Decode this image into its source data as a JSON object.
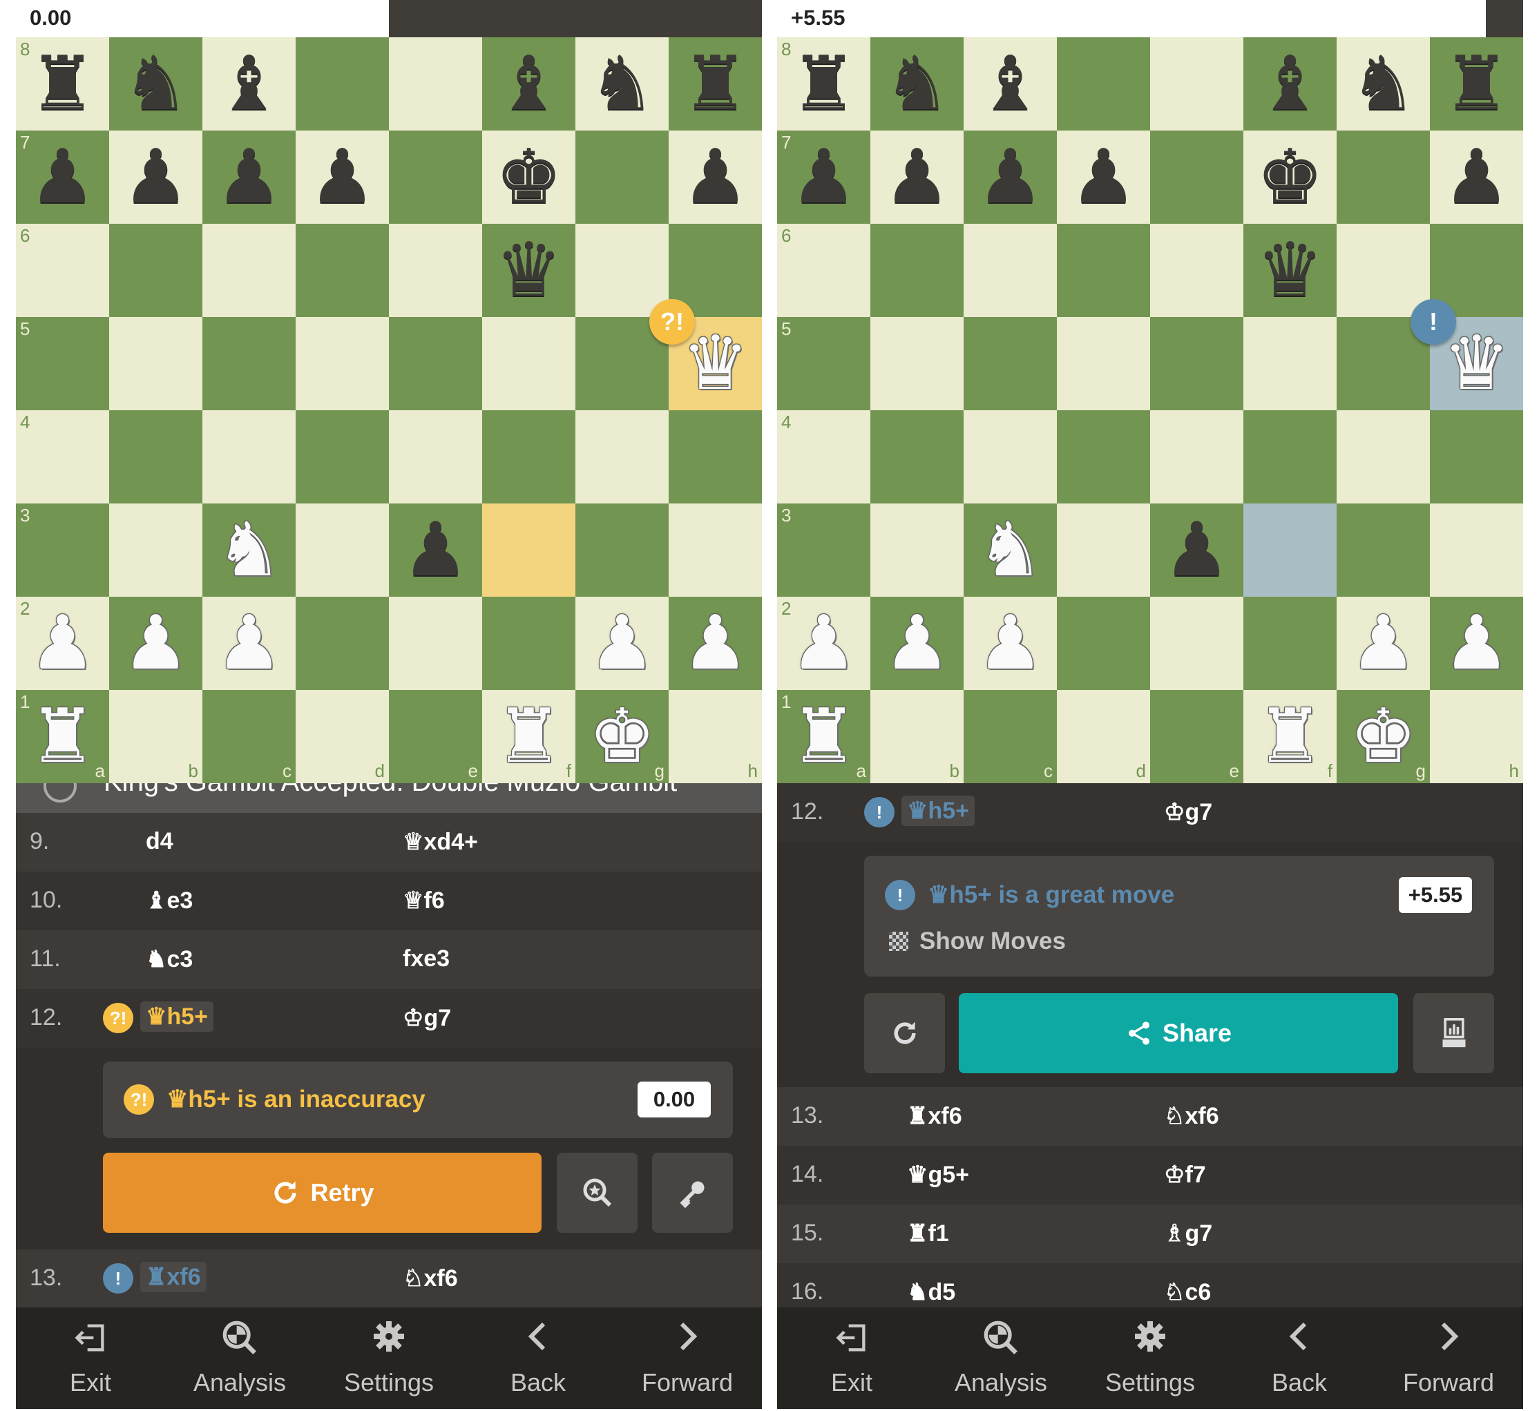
{
  "colors": {
    "light": "#ebecd0",
    "dark": "#739552",
    "inaccuracy": "#f7c045",
    "great": "#5c8bb0",
    "retry": "#e6912c",
    "share": "#0fa9a4"
  },
  "files": [
    "a",
    "b",
    "c",
    "d",
    "e",
    "f",
    "g",
    "h"
  ],
  "panels": [
    {
      "eval": {
        "text": "0.00",
        "white_fraction": 0.5
      },
      "board": {
        "rows": [
          "rnb..bnr",
          "pppp.k.p",
          ".....q..",
          ".......Q",
          "........",
          "..N.p...",
          "PPP...PP",
          "R....RK."
        ],
        "highlights": [
          "h5",
          "f3"
        ],
        "highlight_color": "#f3d580",
        "badge": {
          "square": "h5",
          "symbol": "?!",
          "color": "#f7c045",
          "icon": "inaccuracy-icon"
        }
      },
      "opening": "King's Gambit Accepted: Double Muzio Gambit",
      "moves_before": [
        {
          "num": "9.",
          "white": "d4",
          "black": "♕xd4+"
        },
        {
          "num": "10.",
          "white": "♝e3",
          "black": "♕f6"
        },
        {
          "num": "11.",
          "white": "♞c3",
          "black": "fxe3"
        },
        {
          "num": "12.",
          "white": "♛h5+",
          "black": "♔g7",
          "badge": "?!",
          "badge_color": "#f7c045",
          "white_color": "#f7c045"
        }
      ],
      "feedback": {
        "badge": "?!",
        "color": "#f7c045",
        "text": "♛h5+ is an inaccuracy",
        "eval": "0.00",
        "main_button": {
          "label": "Retry",
          "icon": "retry-icon",
          "color": "#e6912c"
        },
        "side_buttons": [
          "zoom-search-icon",
          "key-icon"
        ]
      },
      "moves_after": [
        {
          "num": "13.",
          "white": "♜xf6",
          "black": "♘xf6",
          "badge": "!",
          "badge_color": "#5c8bb0",
          "white_color": "#5c8bb0"
        }
      ]
    },
    {
      "eval": {
        "text": "+5.55",
        "white_fraction": 0.95
      },
      "board": {
        "rows": [
          "rnb..bnr",
          "pppp.k.p",
          ".....q..",
          ".......Q",
          "........",
          "..N.p...",
          "PPP...PP",
          "R....RK."
        ],
        "highlights": [
          "h5",
          "f3"
        ],
        "highlight_color": "#a9bec5",
        "badge": {
          "square": "h5",
          "symbol": "!",
          "color": "#5c8bb0",
          "icon": "great-move-icon"
        }
      },
      "moves_before": [
        {
          "num": "12.",
          "white": "♛h5+",
          "black": "♔g7",
          "badge": "!",
          "badge_color": "#5c8bb0",
          "white_color": "#5c8bb0"
        }
      ],
      "feedback": {
        "badge": "!",
        "color": "#5c8bb0",
        "text": "♛h5+ is a great move",
        "eval": "+5.55",
        "show_moves": "Show Moves",
        "main_button": {
          "label": "Share",
          "icon": "share-icon",
          "color": "#0fa9a4"
        },
        "side_buttons": [
          "retry-icon",
          "analysis-report-icon"
        ]
      },
      "moves_after": [
        {
          "num": "13.",
          "white": "♜xf6",
          "black": "♘xf6"
        },
        {
          "num": "14.",
          "white": "♛g5+",
          "black": "♔f7"
        },
        {
          "num": "15.",
          "white": "♜f1",
          "black": "♗g7"
        },
        {
          "num": "16.",
          "white": "♞d5",
          "black": "♘c6"
        }
      ]
    }
  ],
  "nav": [
    {
      "label": "Exit",
      "icon": "exit-icon"
    },
    {
      "label": "Analysis",
      "icon": "analysis-icon"
    },
    {
      "label": "Settings",
      "icon": "settings-icon"
    },
    {
      "label": "Back",
      "icon": "chevron-left-icon"
    },
    {
      "label": "Forward",
      "icon": "chevron-right-icon"
    }
  ]
}
